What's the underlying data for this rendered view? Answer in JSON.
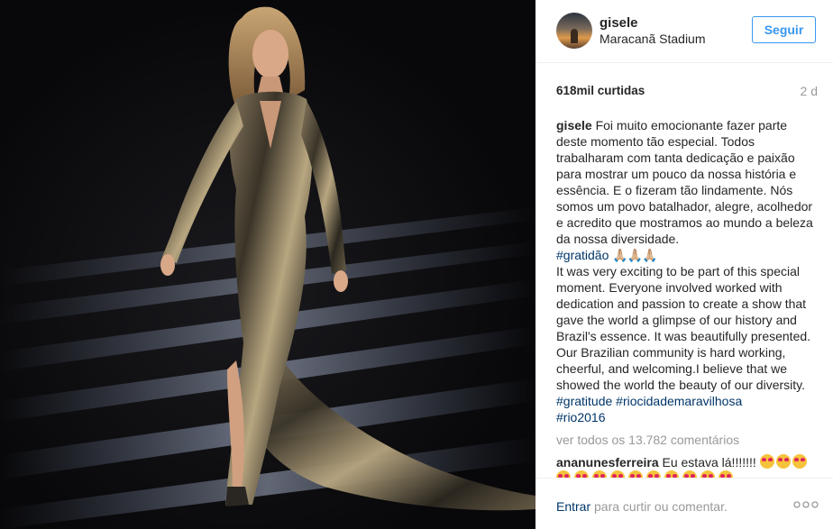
{
  "post": {
    "username": "gisele",
    "location": "Maracanã Stadium",
    "follow_label": "Seguir",
    "likes": "618mil curtidas",
    "age": "2 d"
  },
  "caption": {
    "username": "gisele",
    "text_pt": "Foi muito emocionante fazer parte deste momento tão especial. Todos trabalharam com tanta dedicação e paixão para mostrar um pouco da nossa história e essência. E o fizeram tão lindamente. Nós somos um povo batalhador, alegre, acolhedor e acredito que mostramos ao mundo a beleza da nossa diversidade.",
    "tag_gratidao": "#gratidão",
    "pray_emoji": "🙏🏼🙏🏼🙏🏼",
    "text_en": "It was very exciting to be part of this special moment. Everyone involved worked with dedication and passion to create a show that gave the world a glimpse of our history and Brazil's essence. It was beautifully presented. Our Brazilian community is hard working, cheerful, and welcoming.I believe that we showed the world the beauty of our diversity.",
    "tag_gratitude": "#gratitude",
    "tag_riocidade": "#riocidademaravilhosa",
    "tag_rio2016": "#rio2016"
  },
  "comments": {
    "view_all": "ver todos os 13.782 comentários",
    "first_user": "ananunesferreira",
    "first_text": "Eu estava lá!!!!!!!",
    "first_emoji_icon": "heart-eyes-emoji-icon"
  },
  "footer": {
    "login_link": "Entrar",
    "login_text": "para curtir ou comentar.",
    "more_icon": "more-options-icon"
  },
  "colors": {
    "link": "#003569",
    "follow": "#3897f0",
    "muted": "#999999"
  }
}
